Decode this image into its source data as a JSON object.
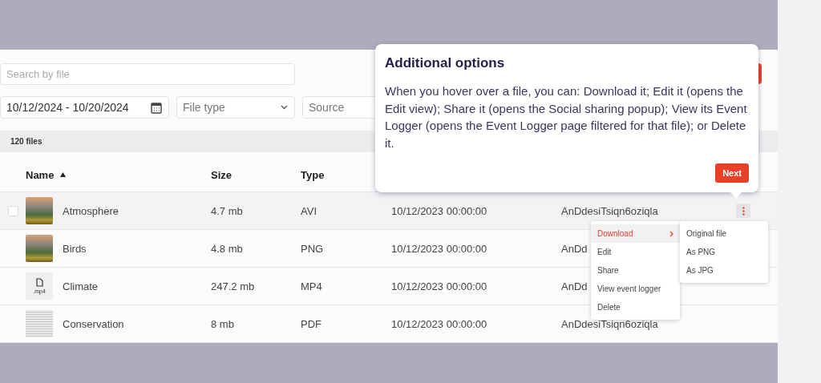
{
  "search": {
    "placeholder": "Search by file"
  },
  "filters": {
    "date_range": "10/12/2024 - 10/20/2024",
    "file_type": {
      "placeholder": "File type"
    },
    "source": {
      "placeholder": "Source"
    }
  },
  "file_count": "120 files",
  "table": {
    "columns": [
      {
        "label": "Name",
        "sorted": true
      },
      {
        "label": "Size",
        "sorted": false
      },
      {
        "label": "Type",
        "sorted": false
      }
    ],
    "rows": [
      {
        "name": "Atmosphere",
        "thumbnail": {
          "kind": "photo"
        },
        "size": "4.7 mb",
        "type": "AVI",
        "date": "10/12/2023 00:00:00",
        "column_5": "AnDdesiTsiqn6oziqla",
        "hovered": true
      },
      {
        "name": "Birds",
        "thumbnail": {
          "kind": "photo"
        },
        "size": "4.8 mb",
        "type": "PNG",
        "date": "10/12/2023 00:00:00",
        "column_5": "AnDd",
        "hovered": false
      },
      {
        "name": "Climate",
        "thumbnail": {
          "kind": "file",
          "caption": ".mp4"
        },
        "size": "247.2 mb",
        "type": "MP4",
        "date": "10/12/2023 00:00:00",
        "column_5": "AnDd",
        "hovered": false
      },
      {
        "name": "Conservation",
        "thumbnail": {
          "kind": "document"
        },
        "size": "8 mb",
        "type": "PDF",
        "date": "10/12/2023 00:00:00",
        "column_5": "AnDdesiTsiqn6oziqla",
        "hovered": false
      }
    ]
  },
  "tooltip": {
    "title": "Additional options",
    "body": "When you hover over a file, you can: Download it; Edit it (opens the Edit view); Share it (opens the Social sharing popup); View its Event Logger (opens the Event Logger page filtered for that file); or Delete it.",
    "button": "Next"
  },
  "context_menu": {
    "items": [
      {
        "label": "Download",
        "selected": true,
        "has_submenu": true
      },
      {
        "label": "Edit",
        "selected": false,
        "has_submenu": false
      },
      {
        "label": "Share",
        "selected": false,
        "has_submenu": false
      },
      {
        "label": "View event logger",
        "selected": false,
        "has_submenu": false
      },
      {
        "label": "Delete",
        "selected": false,
        "has_submenu": false
      }
    ]
  },
  "submenu": {
    "items": [
      {
        "label": "Original file"
      },
      {
        "label": "As PNG"
      },
      {
        "label": "As JPG"
      }
    ]
  }
}
